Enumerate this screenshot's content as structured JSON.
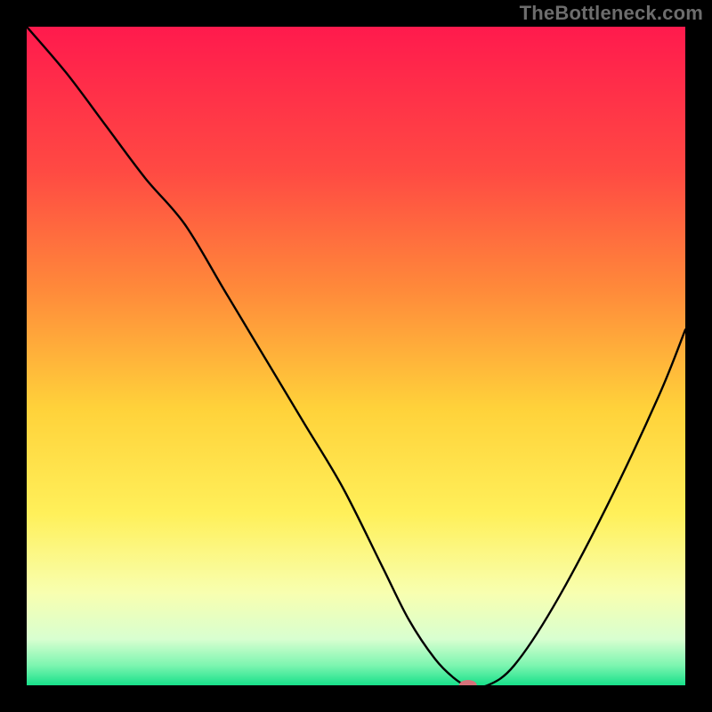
{
  "watermark": "TheBottleneck.com",
  "chart_data": {
    "type": "line",
    "title": "",
    "xlabel": "",
    "ylabel": "",
    "xlim": [
      0,
      100
    ],
    "ylim": [
      0,
      100
    ],
    "grid": false,
    "legend": false,
    "background_gradient": {
      "stops": [
        {
          "pos": 0.0,
          "color": "#ff1a4d"
        },
        {
          "pos": 0.22,
          "color": "#ff4a43"
        },
        {
          "pos": 0.4,
          "color": "#ff8a3a"
        },
        {
          "pos": 0.58,
          "color": "#ffd23a"
        },
        {
          "pos": 0.74,
          "color": "#fff05a"
        },
        {
          "pos": 0.86,
          "color": "#f8ffb0"
        },
        {
          "pos": 0.93,
          "color": "#d8ffd0"
        },
        {
          "pos": 0.97,
          "color": "#7cf5b0"
        },
        {
          "pos": 1.0,
          "color": "#18e08a"
        }
      ]
    },
    "series": [
      {
        "name": "bottleneck-curve",
        "x": [
          0,
          6,
          12,
          18,
          24,
          30,
          36,
          42,
          48,
          54,
          58,
          62,
          65,
          67,
          70,
          74,
          80,
          88,
          96,
          100
        ],
        "y": [
          100,
          93,
          85,
          77,
          70,
          60,
          50,
          40,
          30,
          18,
          10,
          4,
          1,
          0,
          0,
          3,
          12,
          27,
          44,
          54
        ]
      }
    ],
    "marker": {
      "name": "optimal-point",
      "x": 67,
      "y": 0,
      "color": "#d6717a",
      "rx": 10,
      "ry": 6
    }
  }
}
